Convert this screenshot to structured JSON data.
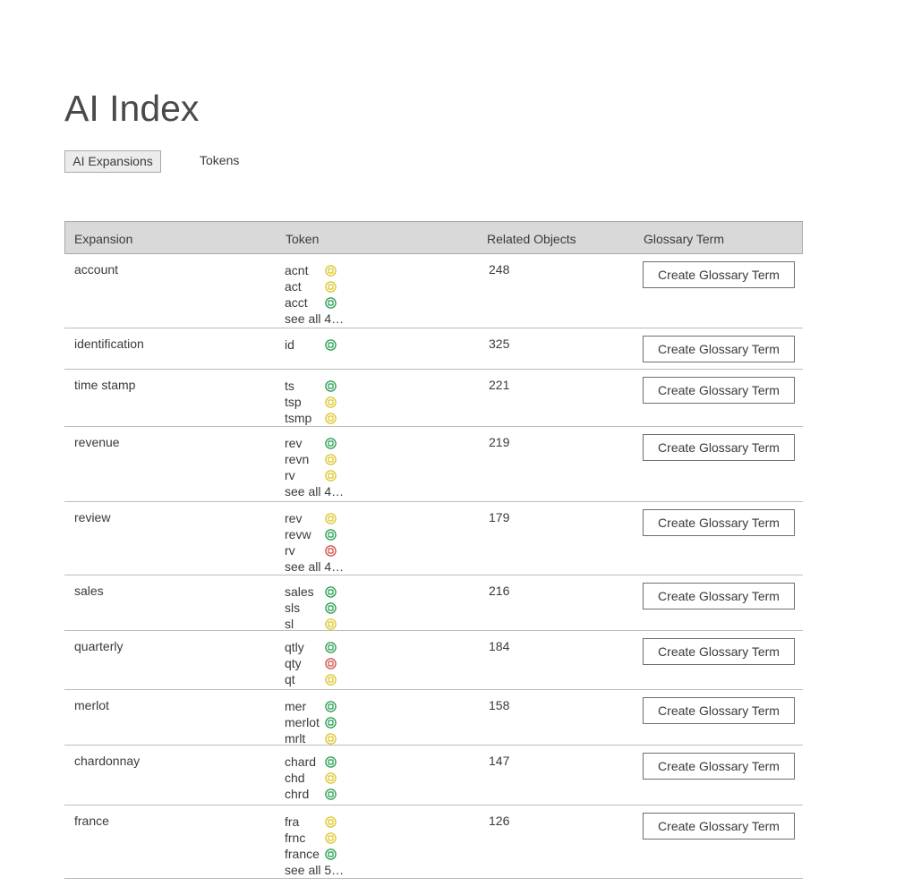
{
  "page": {
    "title": "AI Index"
  },
  "tabs": [
    {
      "label": "AI Expansions",
      "active": true
    },
    {
      "label": "Tokens",
      "active": false
    }
  ],
  "colors": {
    "green": "#1e9a4c",
    "yellow": "#dcc31c",
    "red": "#d2473f"
  },
  "table": {
    "headers": [
      "Expansion",
      "Token",
      "Related Objects",
      "Glossary Term"
    ],
    "rows": [
      {
        "expansion": "account",
        "related": "248",
        "button": "Create Glossary Term",
        "tokens": [
          {
            "text": "acnt",
            "status": "yellow"
          },
          {
            "text": "act",
            "status": "yellow"
          },
          {
            "text": "acct",
            "status": "green"
          }
        ],
        "see_all": "see all 4…"
      },
      {
        "expansion": "identification",
        "related": "325",
        "button": "Create Glossary Term",
        "tokens": [
          {
            "text": "id",
            "status": "green"
          }
        ]
      },
      {
        "expansion": "time stamp",
        "related": "221",
        "button": "Create Glossary Term",
        "tokens": [
          {
            "text": "ts",
            "status": "green"
          },
          {
            "text": "tsp",
            "status": "yellow"
          },
          {
            "text": "tsmp",
            "status": "yellow"
          }
        ]
      },
      {
        "expansion": "revenue",
        "related": "219",
        "button": "Create Glossary Term",
        "tokens": [
          {
            "text": "rev",
            "status": "green"
          },
          {
            "text": "revn",
            "status": "yellow"
          },
          {
            "text": "rv",
            "status": "yellow"
          }
        ],
        "see_all": "see all 4…"
      },
      {
        "expansion": "review",
        "related": "179",
        "button": "Create Glossary Term",
        "tokens": [
          {
            "text": "rev",
            "status": "yellow"
          },
          {
            "text": "revw",
            "status": "green"
          },
          {
            "text": "rv",
            "status": "red"
          }
        ],
        "see_all": "see all 4…"
      },
      {
        "expansion": "sales",
        "related": "216",
        "button": "Create Glossary Term",
        "tokens": [
          {
            "text": "sales",
            "status": "green"
          },
          {
            "text": "sls",
            "status": "green"
          },
          {
            "text": "sl",
            "status": "yellow"
          }
        ]
      },
      {
        "expansion": "quarterly",
        "related": "184",
        "button": "Create Glossary Term",
        "tokens": [
          {
            "text": "qtly",
            "status": "green"
          },
          {
            "text": "qty",
            "status": "red"
          },
          {
            "text": "qt",
            "status": "yellow"
          }
        ]
      },
      {
        "expansion": "merlot",
        "related": "158",
        "button": "Create Glossary Term",
        "tokens": [
          {
            "text": "mer",
            "status": "green"
          },
          {
            "text": "merlot",
            "status": "green"
          },
          {
            "text": "mrlt",
            "status": "yellow"
          }
        ]
      },
      {
        "expansion": "chardonnay",
        "related": "147",
        "button": "Create Glossary Term",
        "tokens": [
          {
            "text": "chard",
            "status": "green"
          },
          {
            "text": "chd",
            "status": "yellow"
          },
          {
            "text": "chrd",
            "status": "green"
          }
        ]
      },
      {
        "expansion": "france",
        "related": "126",
        "button": "Create Glossary Term",
        "tokens": [
          {
            "text": "fra",
            "status": "yellow"
          },
          {
            "text": "frnc",
            "status": "yellow"
          },
          {
            "text": "france",
            "status": "green"
          }
        ],
        "see_all": "see all 5…"
      }
    ]
  }
}
